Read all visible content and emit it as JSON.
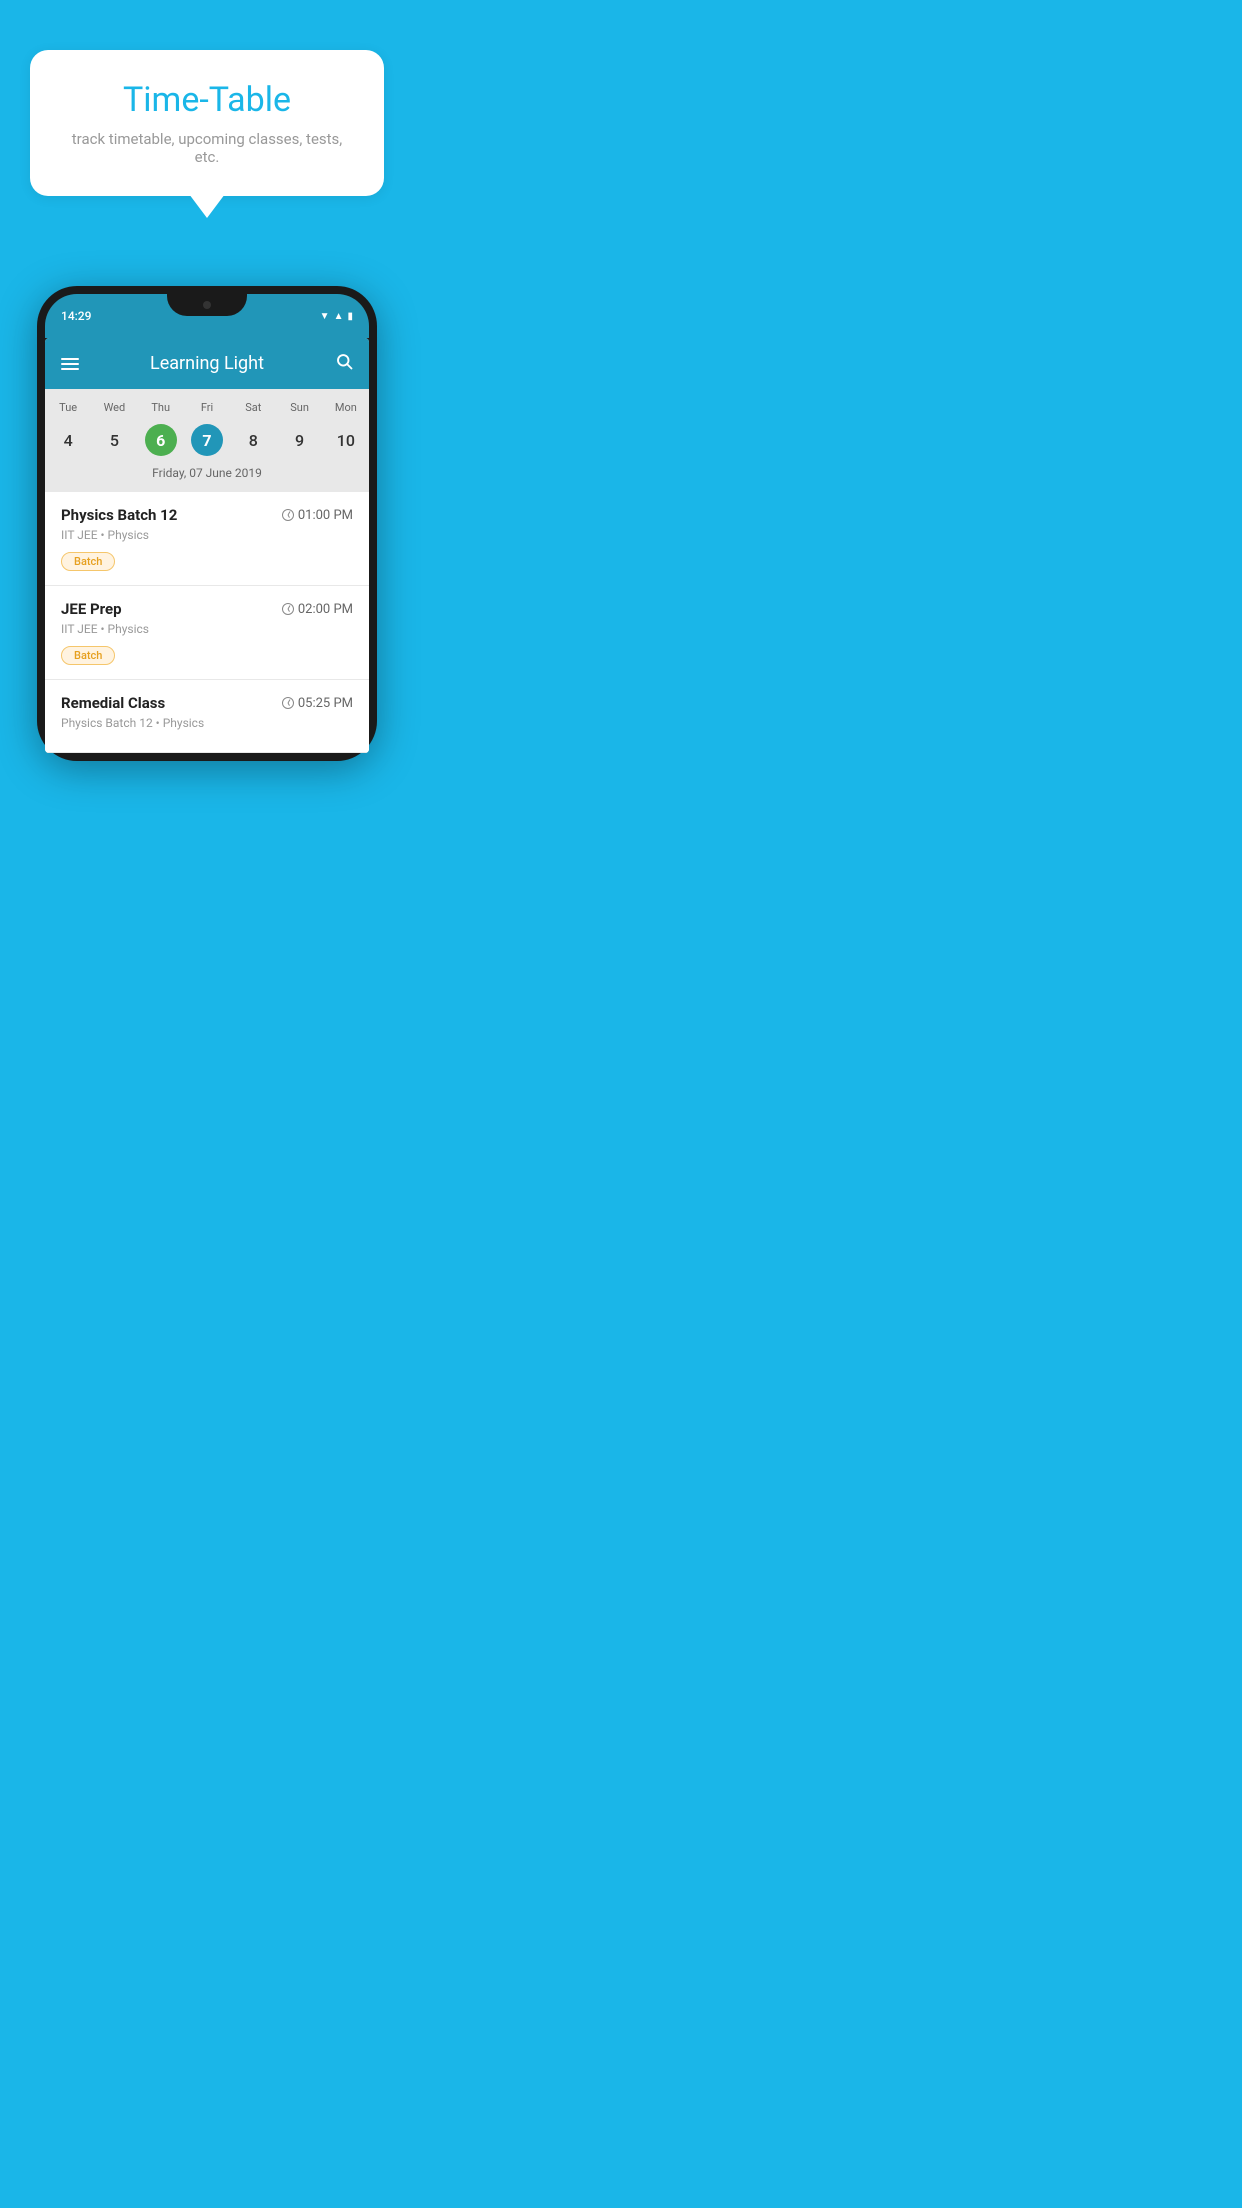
{
  "bubble": {
    "title": "Time-Table",
    "subtitle": "track timetable, upcoming classes, tests, etc."
  },
  "phone": {
    "status": {
      "time": "14:29"
    },
    "header": {
      "title": "Learning Light"
    },
    "calendar": {
      "weekdays": [
        "Tue",
        "Wed",
        "Thu",
        "Fri",
        "Sat",
        "Sun",
        "Mon"
      ],
      "dates": [
        "4",
        "5",
        "6",
        "7",
        "8",
        "9",
        "10"
      ],
      "today_index": 2,
      "selected_index": 3,
      "date_label": "Friday, 07 June 2019"
    },
    "schedule": [
      {
        "title": "Physics Batch 12",
        "time": "01:00 PM",
        "subtitle": "IIT JEE • Physics",
        "tag": "Batch"
      },
      {
        "title": "JEE Prep",
        "time": "02:00 PM",
        "subtitle": "IIT JEE • Physics",
        "tag": "Batch"
      },
      {
        "title": "Remedial Class",
        "time": "05:25 PM",
        "subtitle": "Physics Batch 12 • Physics",
        "tag": ""
      }
    ]
  }
}
